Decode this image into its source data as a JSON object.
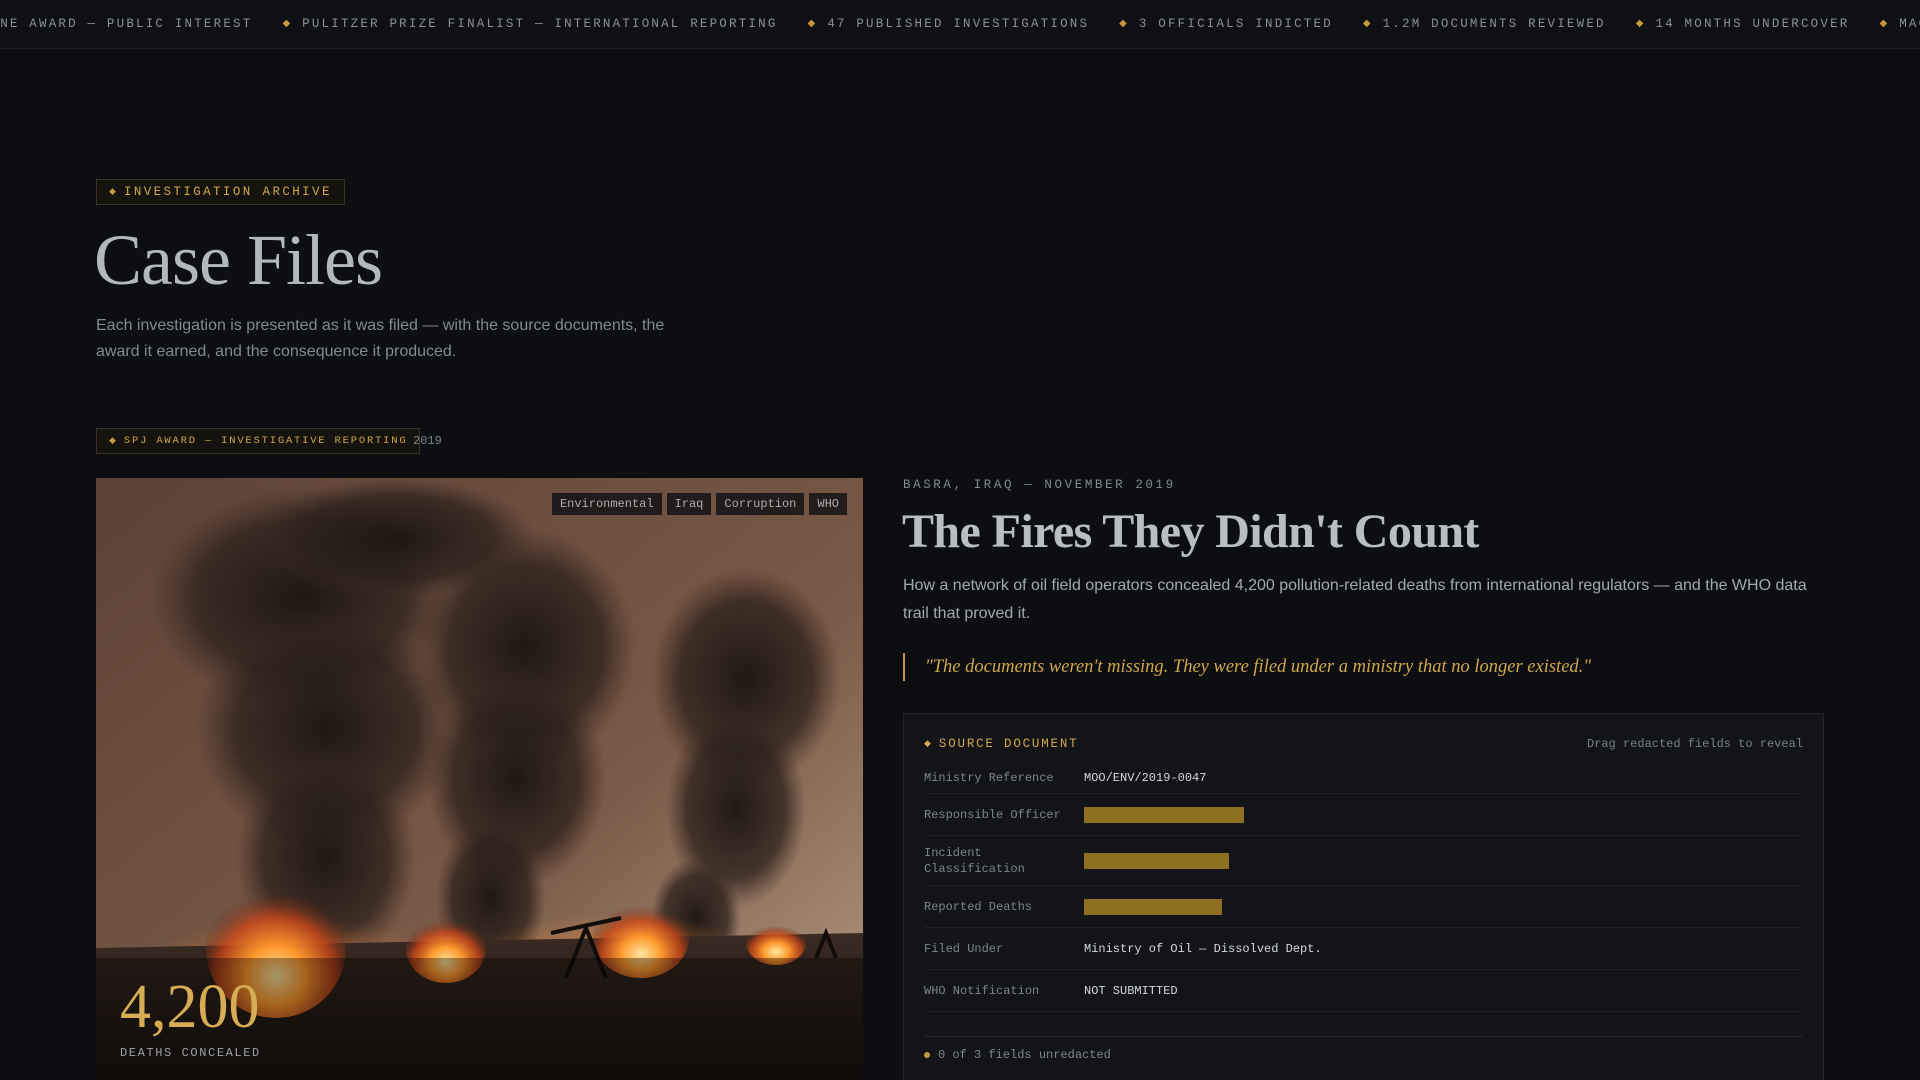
{
  "ticker": {
    "items": [
      "Magazine Award — Public Interest",
      "Pulitzer Prize Finalist — International Reporting",
      "47 Published Investigations",
      "3 Officials Indicted",
      "1.2M Documents Reviewed",
      "14 Months Undercover"
    ]
  },
  "header": {
    "eyebrow": "Investigation Archive",
    "title": "Case Files",
    "intro": "Each investigation is presented as it was filed — with the source documents, the award it earned, and the consequence it produced."
  },
  "case": {
    "award": "SPJ Award — Investigative Reporting",
    "year": "2019",
    "tags": [
      "Environmental",
      "Iraq",
      "Corruption",
      "WHO"
    ],
    "stat_number": "4,200",
    "stat_label": "Deaths Concealed",
    "dateline": "Basra, Iraq — November 2019",
    "title": "The Fires They Didn't Count",
    "dek": "How a network of oil field operators concealed 4,200 pollution-related deaths from international regulators — and the WHO data trail that proved it.",
    "quote": "\"The documents weren't missing. They were filed under a ministry that no longer existed.\""
  },
  "document": {
    "title": "Source Document",
    "hint": "Drag redacted fields to reveal",
    "rows": [
      {
        "label": "Ministry Reference",
        "value": "MOO/ENV/2019-0047",
        "redacted": false
      },
      {
        "label": "Responsible Officer",
        "value": "",
        "redacted": true,
        "bar_fraction": 0.16
      },
      {
        "label": "Incident Classification",
        "value": "",
        "redacted": true,
        "bar_fraction": 0.145
      },
      {
        "label": "Reported Deaths",
        "value": "",
        "redacted": true,
        "bar_fraction": 0.138
      },
      {
        "label": "Filed Under",
        "value": "Ministry of Oil — Dissolved Dept.",
        "redacted": false
      },
      {
        "label": "WHO Notification",
        "value": "NOT SUBMITTED",
        "redacted": false
      }
    ],
    "status": "0 of 3 fields unredacted"
  },
  "colors": {
    "background": "#0c0e11",
    "accent_gold": "#d1a74a",
    "redaction": "#8e6f22"
  }
}
